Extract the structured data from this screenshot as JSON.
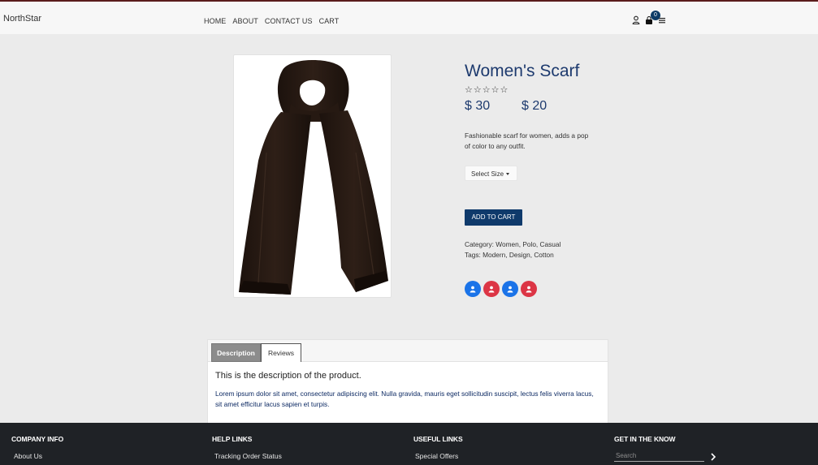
{
  "nav": {
    "brand": "NorthStar",
    "links": [
      "HOME",
      "ABOUT",
      "CONTACT US",
      "CART"
    ],
    "cart_count": "0",
    "icons": [
      "user-icon",
      "shopping-bag-icon",
      "menu-icon"
    ]
  },
  "product": {
    "title": "Women's Scarf",
    "rating_stars": "☆☆☆☆☆",
    "rating_value": 0,
    "price_original": "$ 30",
    "price_sale": "$ 20",
    "description": "Fashionable scarf for women, adds a pop of color to any outfit.",
    "size_select": "Select Size",
    "add_to_cart": "ADD TO CART",
    "category": "Category: Women, Polo, Casual",
    "tags": "Tags: Modern, Design, Cotton",
    "share_icons": [
      {
        "name": "user-icon",
        "color": "#1a73e8"
      },
      {
        "name": "user-icon",
        "color": "#dc3545"
      },
      {
        "name": "user-icon",
        "color": "#1a73e8"
      },
      {
        "name": "user-icon",
        "color": "#dc3545"
      }
    ]
  },
  "tabs": {
    "items": [
      "Description",
      "Reviews"
    ],
    "active": "Description",
    "heading": "This is the description of the product.",
    "body": "Lorem ipsum dolor sit amet, consectetur adipiscing elit. Nulla gravida, mauris eget sollicitudin suscipit, lectus felis viverra lacus, sit amet efficitur lacus sapien et turpis."
  },
  "footer": {
    "columns": [
      {
        "title": "COMPANY INFO",
        "link": "About Us"
      },
      {
        "title": "HELP LINKS",
        "link": "Tracking Order Status"
      },
      {
        "title": "USEFUL LINKS",
        "link": "Special Offers"
      },
      {
        "title": "GET IN THE KNOW"
      }
    ],
    "search_placeholder": "Search"
  },
  "colors": {
    "accent": "#1d3a6e",
    "button": "#0f3a6b",
    "footer_bg": "#1f2226",
    "page_bg": "#ebebeb"
  }
}
